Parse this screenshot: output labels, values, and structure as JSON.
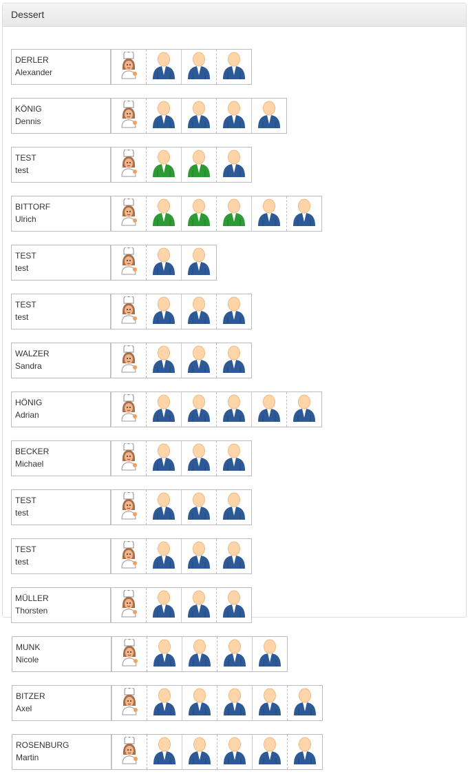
{
  "panel": {
    "title": "Dessert"
  },
  "colors": {
    "guest": "#2d5a96",
    "guest_highlight": "#2e9a36",
    "head": "#fdd5a8"
  },
  "tables": [
    {
      "last": "DERLER",
      "first": "Alexander",
      "guests": [
        "blue",
        "blue",
        "blue"
      ]
    },
    {
      "last": "KÖNIG",
      "first": "Dennis",
      "guests": [
        "blue",
        "blue",
        "blue",
        "blue"
      ]
    },
    {
      "last": "TEST",
      "first": "test",
      "guests": [
        "green",
        "green",
        "blue"
      ]
    },
    {
      "last": "BITTORF",
      "first": "Ulrich",
      "guests": [
        "green",
        "green",
        "green",
        "blue",
        "blue"
      ]
    },
    {
      "last": "TEST",
      "first": "test",
      "guests": [
        "blue",
        "blue"
      ]
    },
    {
      "last": "TEST",
      "first": "test",
      "guests": [
        "blue",
        "blue",
        "blue"
      ]
    },
    {
      "last": "WALZER",
      "first": "Sandra",
      "guests": [
        "blue",
        "blue",
        "blue"
      ]
    },
    {
      "last": "HÖNIG",
      "first": "Adrian",
      "guests": [
        "blue",
        "blue",
        "blue",
        "blue",
        "blue"
      ]
    },
    {
      "last": "BECKER",
      "first": "Michael",
      "guests": [
        "blue",
        "blue",
        "blue"
      ]
    },
    {
      "last": "TEST",
      "first": "test",
      "guests": [
        "blue",
        "blue",
        "blue"
      ]
    },
    {
      "last": "TEST",
      "first": "test",
      "guests": [
        "blue",
        "blue",
        "blue"
      ]
    },
    {
      "last": "MÜLLER",
      "first": "Thorsten",
      "guests": [
        "blue",
        "blue",
        "blue"
      ]
    },
    {
      "last": "MUNK",
      "first": "Nicole",
      "guests": [
        "blue",
        "blue",
        "blue",
        "blue"
      ]
    },
    {
      "last": "BITZER",
      "first": "Axel",
      "guests": [
        "blue",
        "blue",
        "blue",
        "blue",
        "blue"
      ]
    },
    {
      "last": "ROSENBURG",
      "first": "Martin",
      "guests": [
        "blue",
        "blue",
        "blue",
        "blue",
        "blue"
      ]
    }
  ]
}
